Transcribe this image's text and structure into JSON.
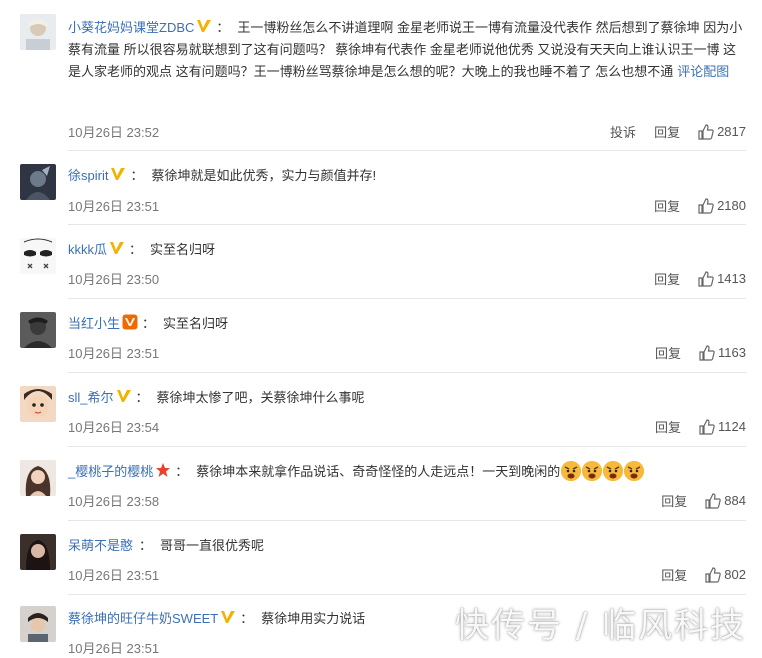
{
  "comments": [
    {
      "user": "小葵花妈妈课堂ZDBC",
      "text": "王一博粉丝怎么不讲道理啊 金星老师说王一博有流量没代表作 然后想到了蔡徐坤 因为小蔡有流量 所以很容易就联想到了这有问题吗？ 蔡徐坤有代表作 金星老师说他优秀 又说没有天天向上谁认识王一博 这是人家老师的观点 这有问题吗？王一博粉丝骂蔡徐坤是怎么想的呢？大晚上的我也睡不着了 怎么也想不通",
      "pic_link": "评论配图",
      "time": "10月26日 23:52",
      "report": "投诉",
      "reply": "回复",
      "likes": "2817",
      "badge": "gold-v"
    },
    {
      "user": "徐spirit",
      "text": "蔡徐坤就是如此优秀，实力与颜值并存!",
      "time": "10月26日 23:51",
      "reply": "回复",
      "likes": "2180",
      "badge": "gold-v"
    },
    {
      "user": "kkkk瓜",
      "text": "实至名归呀",
      "time": "10月26日 23:50",
      "reply": "回复",
      "likes": "1413",
      "badge": "gold-v"
    },
    {
      "user": "当红小生",
      "text": "实至名归呀",
      "time": "10月26日 23:51",
      "reply": "回复",
      "likes": "1163",
      "badge": "orange-v"
    },
    {
      "user": "sll_希尔",
      "text": "蔡徐坤太惨了吧，关蔡徐坤什么事呢",
      "time": "10月26日 23:54",
      "reply": "回复",
      "likes": "1124",
      "badge": "gold-v"
    },
    {
      "user": "_樱桃子的樱桃",
      "text": "蔡徐坤本来就拿作品说话、奇奇怪怪的人走远点！一天到晚闲的",
      "time": "10月26日 23:58",
      "reply": "回复",
      "likes": "884",
      "badge": "red-star",
      "emoji_count": 4
    },
    {
      "user": "呆萌不是憨",
      "text": "哥哥一直很优秀呢",
      "time": "10月26日 23:51",
      "reply": "回复",
      "likes": "802",
      "badge": ""
    },
    {
      "user": "蔡徐坤的旺仔牛奶SWEET",
      "text": "蔡徐坤用实力说话",
      "time": "10月26日 23:51",
      "reply": "",
      "likes": "",
      "badge": "gold-v"
    }
  ],
  "watermark": "快传号 / 临风科技",
  "colors": {
    "username": "#3b6fb6",
    "gold_v": "#f0b400",
    "orange_v": "#f06a00",
    "red_star": "#e8412c"
  }
}
